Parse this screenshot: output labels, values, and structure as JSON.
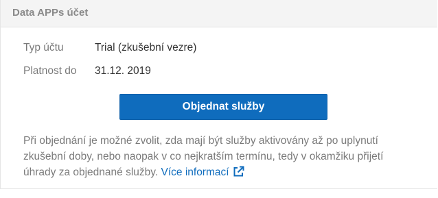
{
  "card": {
    "title": "Data APPs účet"
  },
  "info": {
    "account_type_label": "Typ účtu",
    "account_type_value": "Trial (zkušební vezre)",
    "validity_label": "Platnost do",
    "validity_value": "31.12. 2019"
  },
  "actions": {
    "order_label": "Objednat služby"
  },
  "note": {
    "line1": "Při objednání je možné zvolit, zda mají být služby aktivovány až po uplynutí",
    "line2": "zkušební doby, nebo naopak v co nejkratším termínu, tedy v okamžiku přijetí",
    "line3": "úhrady za objednané služby.",
    "link_label": "Více informací",
    "link_icon": "external-link-icon"
  },
  "colors": {
    "accent": "#0f6cbd",
    "header_bg": "#f4f4f4",
    "muted_text": "#7a7a7a"
  }
}
